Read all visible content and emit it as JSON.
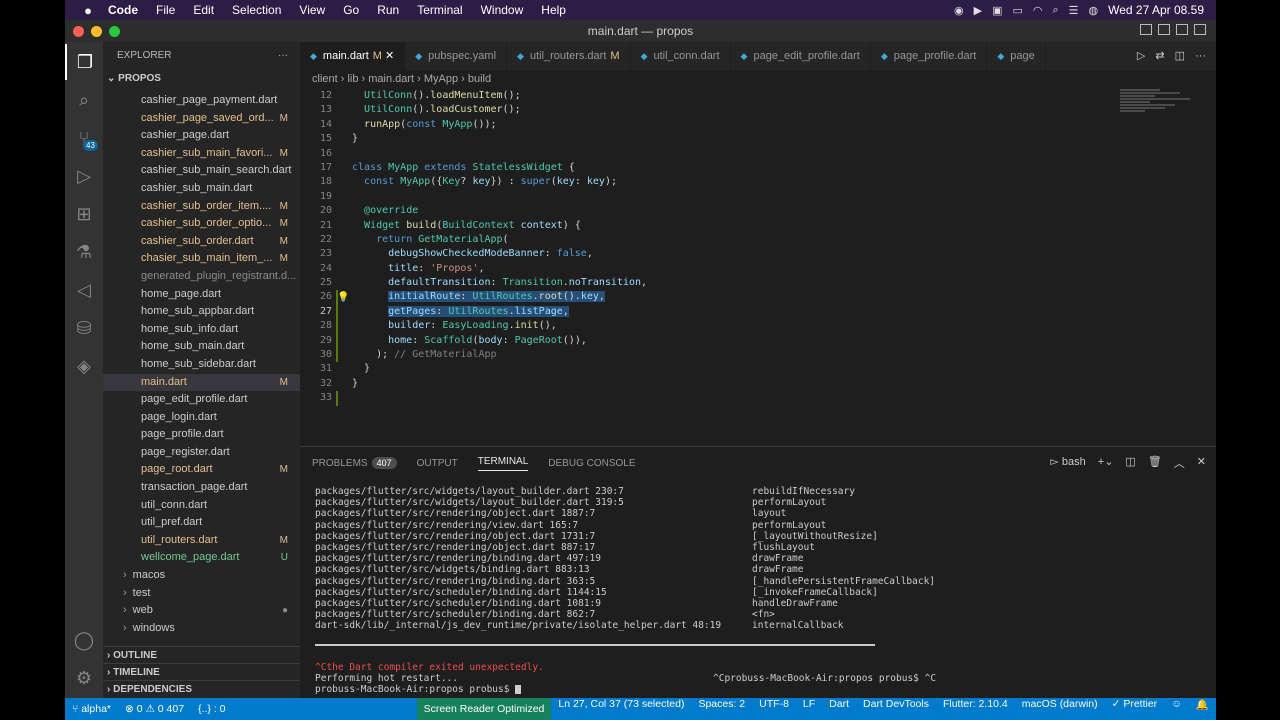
{
  "menubar": {
    "items": [
      "Code",
      "File",
      "Edit",
      "Selection",
      "View",
      "Go",
      "Run",
      "Terminal",
      "Window",
      "Help"
    ],
    "clock": "Wed 27 Apr  08.59"
  },
  "window": {
    "title": "main.dart — propos"
  },
  "activity": {
    "scm_badge": "43"
  },
  "explorer": {
    "header": "EXPLORER",
    "more": "···",
    "project": "PROPOS",
    "files": [
      {
        "name": "cashier_page_payment.dart",
        "status": "",
        "cls": ""
      },
      {
        "name": "cashier_page_saved_ord...",
        "status": "M",
        "cls": "mod"
      },
      {
        "name": "cashier_page.dart",
        "status": "",
        "cls": ""
      },
      {
        "name": "cashier_sub_main_favori...",
        "status": "M",
        "cls": "mod"
      },
      {
        "name": "cashier_sub_main_search.dart",
        "status": "",
        "cls": ""
      },
      {
        "name": "cashier_sub_main.dart",
        "status": "",
        "cls": ""
      },
      {
        "name": "cashier_sub_order_item....",
        "status": "M",
        "cls": "mod"
      },
      {
        "name": "cashier_sub_order_optio...",
        "status": "M",
        "cls": "mod"
      },
      {
        "name": "cashier_sub_order.dart",
        "status": "M",
        "cls": "mod"
      },
      {
        "name": "chasier_sub_main_item_...",
        "status": "M",
        "cls": "mod"
      },
      {
        "name": "generated_plugin_registrant.d...",
        "status": "",
        "cls": "dim"
      },
      {
        "name": "home_page.dart",
        "status": "",
        "cls": ""
      },
      {
        "name": "home_sub_appbar.dart",
        "status": "",
        "cls": ""
      },
      {
        "name": "home_sub_info.dart",
        "status": "",
        "cls": ""
      },
      {
        "name": "home_sub_main.dart",
        "status": "",
        "cls": ""
      },
      {
        "name": "home_sub_sidebar.dart",
        "status": "",
        "cls": ""
      },
      {
        "name": "main.dart",
        "status": "M",
        "cls": "mod sel"
      },
      {
        "name": "page_edit_profile.dart",
        "status": "",
        "cls": ""
      },
      {
        "name": "page_login.dart",
        "status": "",
        "cls": ""
      },
      {
        "name": "page_profile.dart",
        "status": "",
        "cls": ""
      },
      {
        "name": "page_register.dart",
        "status": "",
        "cls": ""
      },
      {
        "name": "page_root.dart",
        "status": "M",
        "cls": "mod"
      },
      {
        "name": "transaction_page.dart",
        "status": "",
        "cls": ""
      },
      {
        "name": "util_conn.dart",
        "status": "",
        "cls": ""
      },
      {
        "name": "util_pref.dart",
        "status": "",
        "cls": ""
      },
      {
        "name": "util_routers.dart",
        "status": "M",
        "cls": "mod"
      },
      {
        "name": "wellcome_page.dart",
        "status": "U",
        "cls": "untr"
      }
    ],
    "folders": [
      {
        "name": "macos",
        "status": ""
      },
      {
        "name": "test",
        "status": ""
      },
      {
        "name": "web",
        "status": "●"
      },
      {
        "name": "windows",
        "status": ""
      }
    ],
    "sections": [
      "OUTLINE",
      "TIMELINE",
      "DEPENDENCIES"
    ]
  },
  "tabs": [
    {
      "label": "main.dart",
      "mark": "M",
      "active": true
    },
    {
      "label": "pubspec.yaml",
      "mark": "",
      "active": false
    },
    {
      "label": "util_routers.dart",
      "mark": "M",
      "active": false
    },
    {
      "label": "util_conn.dart",
      "mark": "",
      "active": false
    },
    {
      "label": "page_edit_profile.dart",
      "mark": "",
      "active": false
    },
    {
      "label": "page_profile.dart",
      "mark": "",
      "active": false
    },
    {
      "label": "page",
      "mark": "",
      "active": false
    }
  ],
  "breadcrumb": "client  ›  lib  ›  main.dart  ›  MyApp  ›  build",
  "code": {
    "lines": [
      {
        "n": "12",
        "html": "  <span class='c'>UtilConn</span>().<span class='f'>loadMenuItem</span>();"
      },
      {
        "n": "13",
        "html": "  <span class='c'>UtilConn</span>().<span class='f'>loadCustomer</span>();"
      },
      {
        "n": "14",
        "html": "  <span class='f'>runApp</span>(<span class='k'>const</span> <span class='c'>MyApp</span>());"
      },
      {
        "n": "15",
        "html": "}"
      },
      {
        "n": "16",
        "html": ""
      },
      {
        "n": "17",
        "html": "<span class='k'>class</span> <span class='c'>MyApp</span> <span class='k'>extends</span> <span class='c'>StatelessWidget</span> {"
      },
      {
        "n": "18",
        "html": "  <span class='k'>const</span> <span class='c'>MyApp</span>({<span class='c'>Key</span>? <span class='p'>key</span>}) : <span class='k'>super</span>(<span class='p'>key</span>: <span class='p'>key</span>);"
      },
      {
        "n": "19",
        "html": ""
      },
      {
        "n": "20",
        "html": "  <span class='c'>@override</span>"
      },
      {
        "n": "21",
        "html": "  <span class='c'>Widget</span> <span class='f'>build</span>(<span class='c'>BuildContext</span> <span class='p'>context</span>) {"
      },
      {
        "n": "22",
        "html": "    <span class='k'>return</span> <span class='c'>GetMaterialApp</span>("
      },
      {
        "n": "23",
        "html": "      <span class='p'>debugShowCheckedModeBanner</span>: <span class='k'>false</span>,"
      },
      {
        "n": "24",
        "html": "      <span class='p'>title</span>: <span class='s'>'Propos'</span>,"
      },
      {
        "n": "25",
        "html": "      <span class='p'>defaultTransition</span>: <span class='c'>Transition</span>.<span class='p'>noTransition</span>,"
      },
      {
        "n": "26",
        "html": "      <span class='hl'><span class='p'>initialRoute</span>: <span class='c'>UtilRoutes</span>.<span class='f'>root</span>().<span class='p'>key</span>,</span>"
      },
      {
        "n": "27",
        "html": "      <span class='hl'><span class='p'>getPages</span>: <span class='c'>UtilRoutes</span>.<span class='p'>listPage</span>,</span>"
      },
      {
        "n": "28",
        "html": "      <span class='p'>builder</span>: <span class='c'>EasyLoading</span>.<span class='f'>init</span>(),"
      },
      {
        "n": "29",
        "html": "      <span class='p'>home</span>: <span class='c'>Scaffold</span>(<span class='p'>body</span>: <span class='c'>PageRoot</span>()),"
      },
      {
        "n": "30",
        "html": "    ); <span class='g'>// GetMaterialApp</span>"
      },
      {
        "n": "31",
        "html": "  }"
      },
      {
        "n": "32",
        "html": "}"
      },
      {
        "n": "33",
        "html": ""
      }
    ]
  },
  "panel": {
    "tabs": [
      "PROBLEMS",
      "OUTPUT",
      "TERMINAL",
      "DEBUG CONSOLE"
    ],
    "problems_count": "407",
    "shell": "bash",
    "stack": [
      {
        "path": "packages/flutter/src/widgets/layout_builder.dart 230:7",
        "fn": "rebuildIfNecessary"
      },
      {
        "path": "packages/flutter/src/widgets/layout_builder.dart 319:5",
        "fn": "performLayout"
      },
      {
        "path": "packages/flutter/src/rendering/object.dart 1887:7",
        "fn": "layout"
      },
      {
        "path": "packages/flutter/src/rendering/view.dart 165:7",
        "fn": "performLayout"
      },
      {
        "path": "packages/flutter/src/rendering/object.dart 1731:7",
        "fn": "[_layoutWithoutResize]"
      },
      {
        "path": "packages/flutter/src/rendering/object.dart 887:17",
        "fn": "flushLayout"
      },
      {
        "path": "packages/flutter/src/rendering/binding.dart 497:19",
        "fn": "drawFrame"
      },
      {
        "path": "packages/flutter/src/widgets/binding.dart 883:13",
        "fn": "drawFrame"
      },
      {
        "path": "packages/flutter/src/rendering/binding.dart 363:5",
        "fn": "[_handlePersistentFrameCallback]"
      },
      {
        "path": "packages/flutter/src/scheduler/binding.dart 1144:15",
        "fn": "[_invokeFrameCallback]"
      },
      {
        "path": "packages/flutter/src/scheduler/binding.dart 1081:9",
        "fn": "handleDrawFrame"
      },
      {
        "path": "packages/flutter/src/scheduler/binding.dart 862:7",
        "fn": "<fn>"
      },
      {
        "path": "dart-sdk/lib/_internal/js_dev_runtime/private/isolate_helper.dart 48:19",
        "fn": "internalCallback"
      }
    ],
    "err_line": "^Cthe Dart compiler exited unexpectedly.",
    "restart_line": "Performing hot restart...",
    "right_prompt": "^Cprobuss-MacBook-Air:propos probus$ ^C",
    "prompt": "probuss-MacBook-Air:propos probus$ "
  },
  "status": {
    "branch": "alpha*",
    "problems": "⊗ 0  ⚠ 0  407",
    "braces": "{..} : 0",
    "reader": "Screen Reader Optimized",
    "cursor": "Ln 27, Col 37 (73 selected)",
    "spaces": "Spaces: 2",
    "encoding": "UTF-8",
    "eol": "LF",
    "lang": "Dart",
    "devtools": "Dart DevTools",
    "flutter": "Flutter: 2.10.4",
    "device": "macOS (darwin)",
    "prettier": "✓ Prettier"
  }
}
